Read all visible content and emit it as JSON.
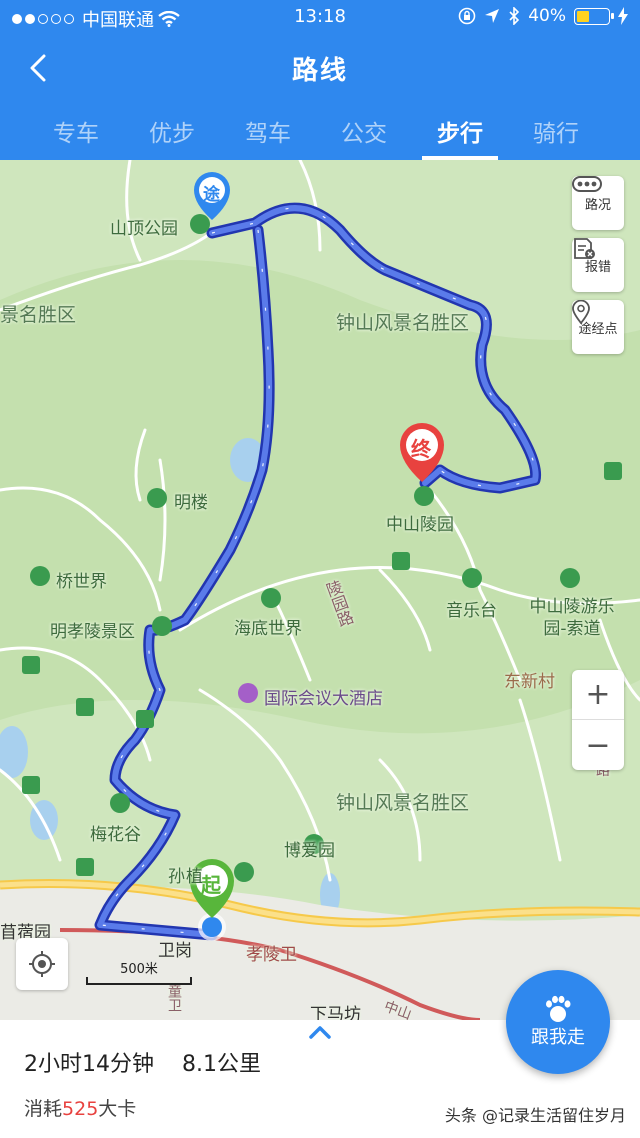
{
  "status_bar": {
    "carrier": "中国联通",
    "time": "13:18",
    "battery": "40%",
    "battery_level": 0.4,
    "signal_bars": 2
  },
  "header": {
    "title": "路线",
    "back_icon": "chevron-left-icon"
  },
  "tabs": [
    {
      "label": "专车",
      "active": false
    },
    {
      "label": "优步",
      "active": false
    },
    {
      "label": "驾车",
      "active": false
    },
    {
      "label": "公交",
      "active": false
    },
    {
      "label": "步行",
      "active": true
    },
    {
      "label": "骑行",
      "active": false
    }
  ],
  "map_controls": {
    "traffic": "路况",
    "report": "报错",
    "waypoint": "途经点",
    "zoom_in": "+",
    "zoom_out": "−"
  },
  "markers": {
    "via": "途",
    "end": "终",
    "start": "起"
  },
  "map_labels": {
    "shanding_park": "山顶公园",
    "scenic_area_left": "景名胜区",
    "zhongshan_scenic_north": "钟山风景名胜区",
    "zhongshan_mausoleum": "中山陵园",
    "ming_tower": "明楼",
    "bridge_world": "桥世界",
    "ming_xiaoling": "明孝陵景区",
    "underwater_world": "海底世界",
    "lingyuan_road": "陵园路",
    "music_stage": "音乐台",
    "zhongshan_ropeway": "中山陵游乐园-索道",
    "dongxin_village": "东新村",
    "conference_hotel": "国际会议大酒店",
    "plum_valley": "梅花谷",
    "zhongshan_scenic_south": "钟山风景名胜区",
    "boai_park": "博爱园",
    "sun_partial": "孙",
    "sun_partial_2": "植",
    "xurong_park": "苜蓿园",
    "weigang": "卫岗",
    "xiaoling_wei": "孝陵卫",
    "xiamafang": "下马坊",
    "dong_partial": "童卫",
    "lu_partial": "路",
    "zhongshan_road_partial": "中山"
  },
  "scale": {
    "label": "500米"
  },
  "follow_button": {
    "label": "跟我走"
  },
  "summary": {
    "duration": "2小时14分钟",
    "distance": "8.1公里",
    "calories_prefix": "消耗",
    "calories_value": "525",
    "calories_suffix": "大卡"
  },
  "watermark": "头条 @记录生活留住岁月",
  "colors": {
    "header_blue": "#2f88ee",
    "route_blue": "#4a63d9",
    "start_green": "#58b63b",
    "end_red": "#e8423f",
    "map_green": "#cfe6bd"
  }
}
